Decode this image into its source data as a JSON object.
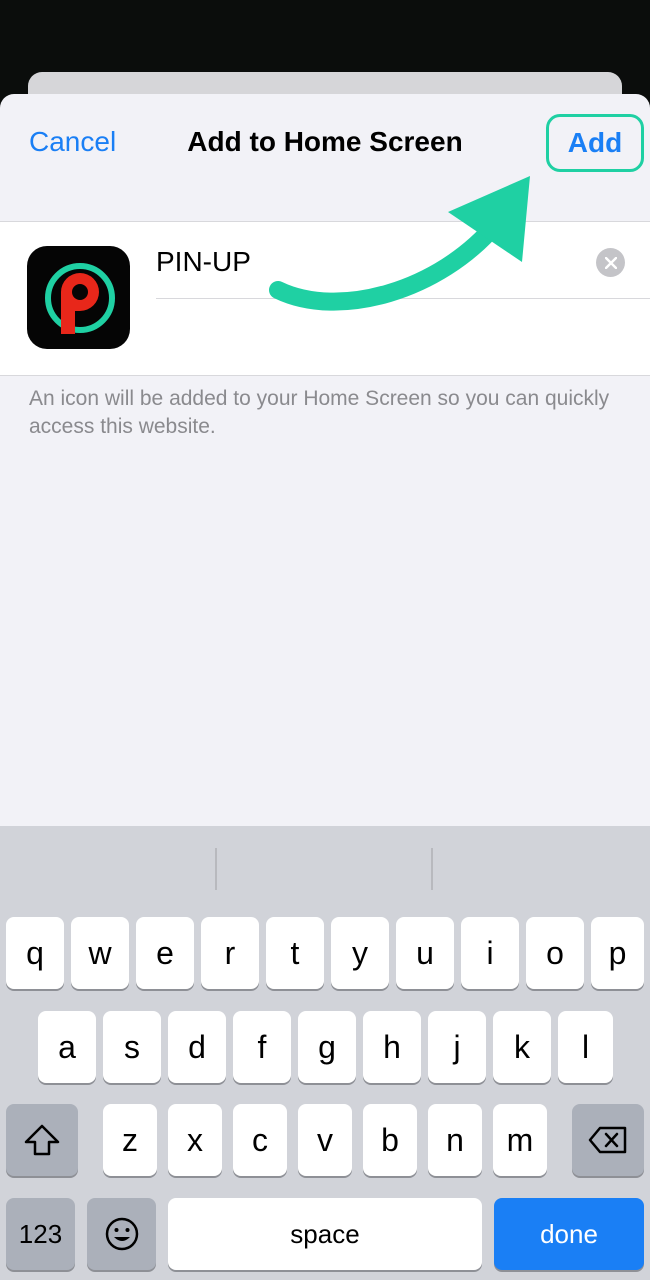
{
  "nav": {
    "cancel_label": "Cancel",
    "title": "Add to Home Screen",
    "add_label": "Add"
  },
  "shortcut": {
    "name_value": "PIN-UP",
    "icon_letter": "P"
  },
  "description": "An icon will be added to your Home Screen so you can quickly access this website.",
  "keyboard": {
    "row1": [
      "q",
      "w",
      "e",
      "r",
      "t",
      "y",
      "u",
      "i",
      "o",
      "p"
    ],
    "row2": [
      "a",
      "s",
      "d",
      "f",
      "g",
      "h",
      "j",
      "k",
      "l"
    ],
    "row3": [
      "z",
      "x",
      "c",
      "v",
      "b",
      "n",
      "m"
    ],
    "numbers_label": "123",
    "space_label": "space",
    "done_label": "done"
  },
  "colors": {
    "accent_blue": "#1a7ff5",
    "highlight_teal": "#1fd0a3",
    "icon_red": "#e8271a"
  }
}
